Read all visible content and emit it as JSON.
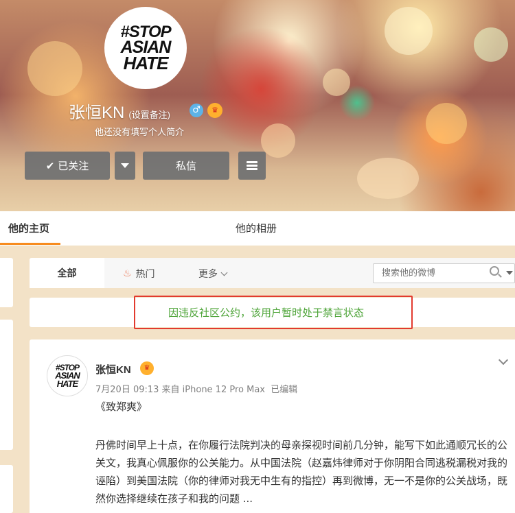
{
  "profile": {
    "avatar_logo": [
      "#STOP",
      "ASIAN",
      "HATE"
    ],
    "name": "张恒KN",
    "remark": "(设置备注)",
    "gender_icon": "male-icon",
    "vip_icon": "vip-crown-icon",
    "bio": "他还没有填写个人简介",
    "follow_label": "已关注",
    "message_label": "私信"
  },
  "tabs": {
    "home": "他的主页",
    "album": "他的相册"
  },
  "filter": {
    "all": "全部",
    "hot": "热门",
    "more": "更多",
    "search_placeholder": "搜索他的微博"
  },
  "notice": {
    "text": "因违反社区公约，该用户暂时处于禁言状态"
  },
  "post": {
    "author": "张恒KN",
    "meta": "7月20日 09:13 来自 iPhone 12 Pro Max  已编辑",
    "title": "《致郑爽》",
    "body": "丹佛时间早上十点，在你履行法院判决的母亲探视时间前几分钟，能写下如此通顺冗长的公关文，我真心佩服你的公关能力。从中国法院（赵嘉炜律师对于你阴阳合同逃税漏税对我的诬陷）到美国法院（你的律师对我无中生有的指控）再到微博，无一不是你的公关战场，既然你选择继续在孩子和我的问题 ..."
  },
  "colors": {
    "accent": "#f78c1f",
    "notice_text": "#4fa53a",
    "notice_border": "#e23a2e"
  }
}
